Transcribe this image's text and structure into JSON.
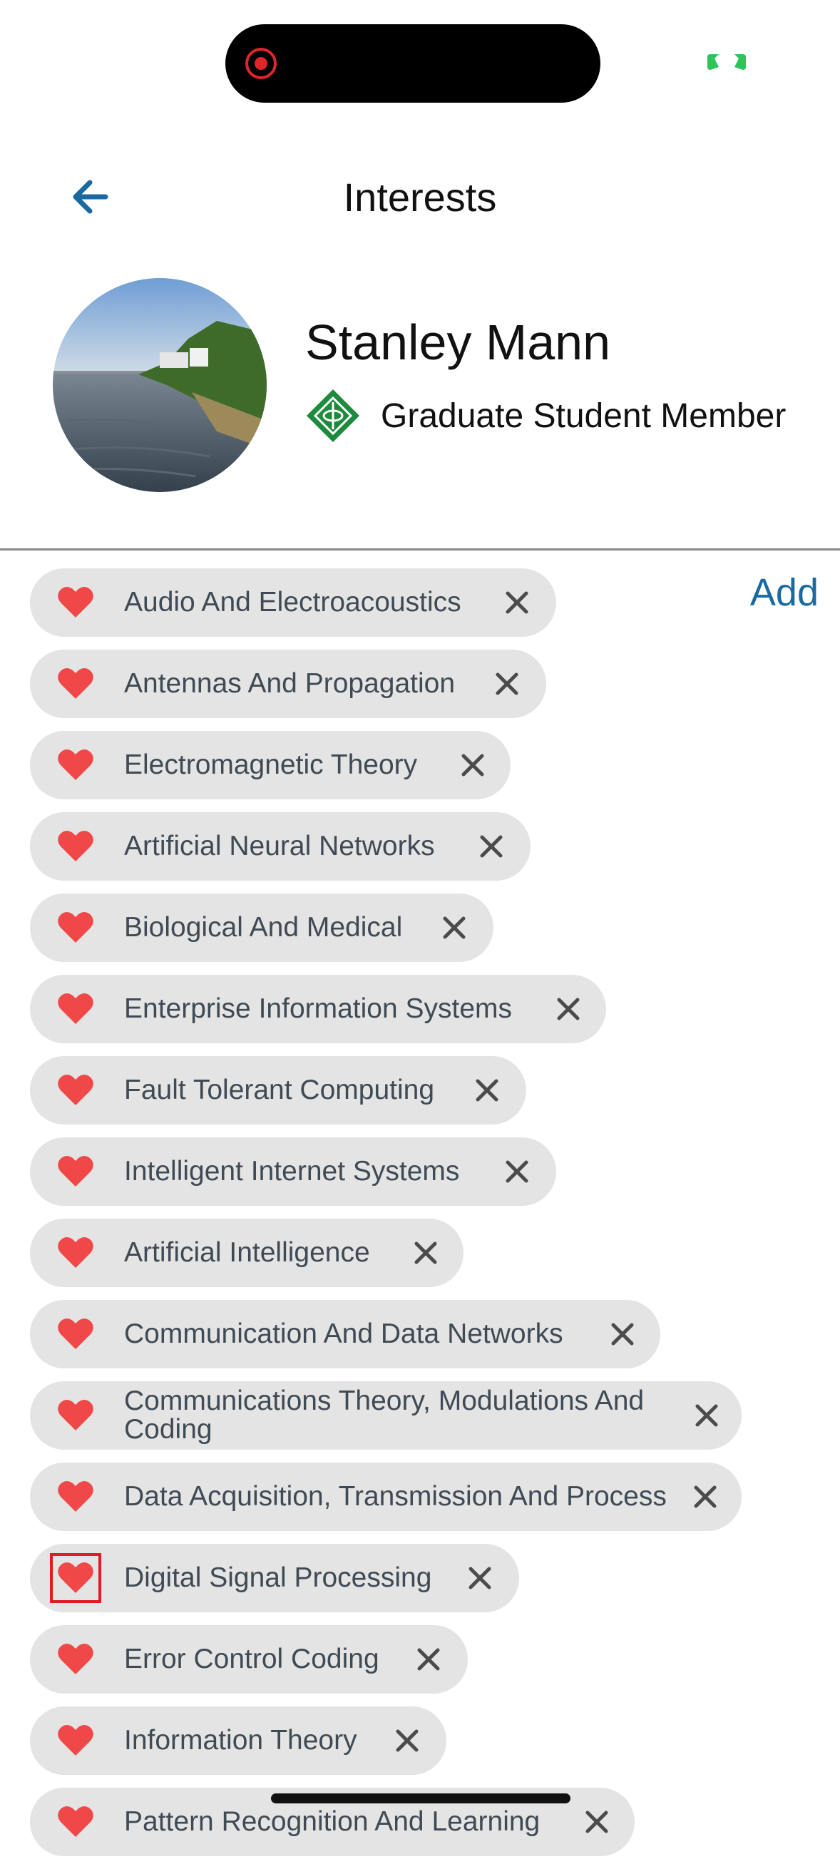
{
  "header": {
    "title": "Interests",
    "back_icon": "back-arrow-icon"
  },
  "profile": {
    "name": "Stanley Mann",
    "membership": "Graduate Student Member"
  },
  "actions": {
    "add_label": "Add"
  },
  "colors": {
    "accent": "#1a6aa0",
    "heart": "#f04848",
    "chip_bg": "#e4e4e4",
    "chip_text": "#3f4a55",
    "member_logo": "#1e8a3c"
  },
  "interests": [
    "Audio And Electroacoustics",
    "Antennas And Propagation",
    "Electromagnetic Theory",
    "Artificial Neural Networks",
    "Biological And Medical",
    "Enterprise Information Systems",
    "Fault Tolerant Computing",
    "Intelligent Internet Systems",
    "Artificial Intelligence",
    "Communication And Data Networks",
    "Communications Theory, Modulations And Coding",
    "Data Acquisition, Transmission And Process",
    "Digital Signal Processing",
    "Error Control Coding",
    "Information Theory",
    "Pattern Recognition And Learning"
  ]
}
